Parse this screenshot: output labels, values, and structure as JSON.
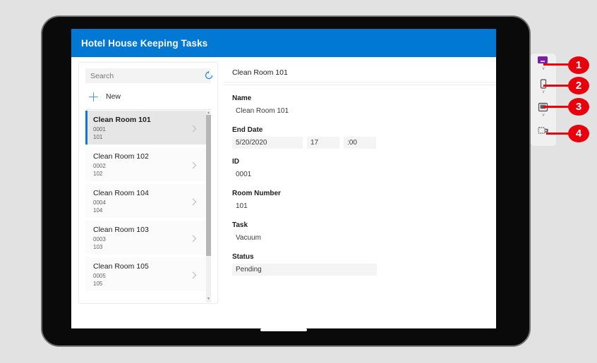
{
  "app": {
    "title": "Hotel House Keeping Tasks",
    "header_color": "#0078d4"
  },
  "gallery": {
    "search": {
      "placeholder": "Search",
      "value": "",
      "refresh_icon": "refresh-icon"
    },
    "new_button": {
      "label": "New",
      "icon": "plus-icon"
    },
    "items": [
      {
        "title": "Clean Room 101",
        "id": "0001",
        "room": "101",
        "selected": true
      },
      {
        "title": "Clean Room 102",
        "id": "0002",
        "room": "102",
        "selected": false
      },
      {
        "title": "Clean Room 104",
        "id": "0004",
        "room": "104",
        "selected": false
      },
      {
        "title": "Clean Room 103",
        "id": "0003",
        "room": "103",
        "selected": false
      },
      {
        "title": "Clean Room 105",
        "id": "0005",
        "room": "105",
        "selected": false
      }
    ],
    "selection_color": "#1178d4"
  },
  "detail": {
    "header_title": "Clean Room 101",
    "fields": {
      "name_label": "Name",
      "name_value": "Clean Room 101",
      "end_date_label": "End Date",
      "end_date_value": "5/20/2020",
      "end_hour_value": "17",
      "end_minute_value": ":00",
      "id_label": "ID",
      "id_value": "0001",
      "room_label": "Room Number",
      "room_value": "101",
      "task_label": "Task",
      "task_value": "Vacuum",
      "status_label": "Status",
      "status_value": "Pending"
    }
  },
  "toolbar": {
    "items": [
      {
        "icon": "monitor-icon",
        "caret": "∨"
      },
      {
        "icon": "phone-icon",
        "caret": "∨"
      },
      {
        "icon": "tablet-icon",
        "caret": "∨"
      },
      {
        "icon": "print-preview-icon",
        "caret": ""
      }
    ]
  },
  "callouts": [
    {
      "number": "1"
    },
    {
      "number": "2"
    },
    {
      "number": "3"
    },
    {
      "number": "4"
    }
  ],
  "colors": {
    "accent_blue": "#0078d4",
    "callout_red": "#e8000d",
    "purple_icon": "#7b1fa2"
  }
}
